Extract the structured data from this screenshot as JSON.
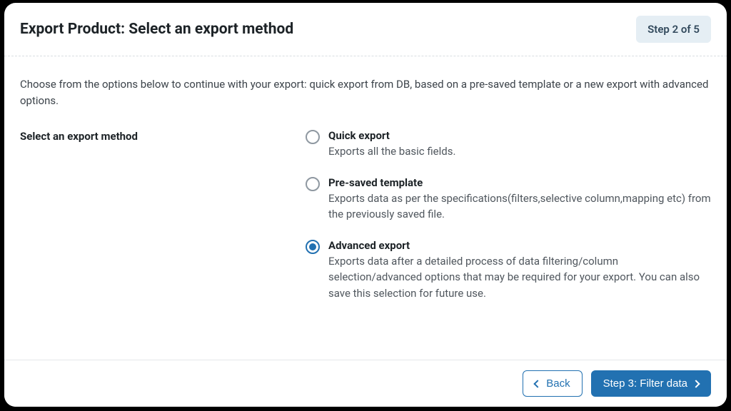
{
  "header": {
    "title": "Export Product: Select an export method",
    "step_badge": "Step 2 of 5"
  },
  "intro": "Choose from the options below to continue with your export: quick export from DB, based on a pre-saved template or a new export with advanced options.",
  "section_label": "Select an export method",
  "options": [
    {
      "title": "Quick export",
      "desc": "Exports all the basic fields.",
      "selected": false
    },
    {
      "title": "Pre-saved template",
      "desc": "Exports data as per the specifications(filters,selective column,mapping etc) from the previously saved file.",
      "selected": false
    },
    {
      "title": "Advanced export",
      "desc": "Exports data after a detailed process of data filtering/column selection/advanced options that may be required for your export. You can also save this selection for future use.",
      "selected": true
    }
  ],
  "footer": {
    "back_label": "Back",
    "next_label": "Step 3: Filter data"
  }
}
